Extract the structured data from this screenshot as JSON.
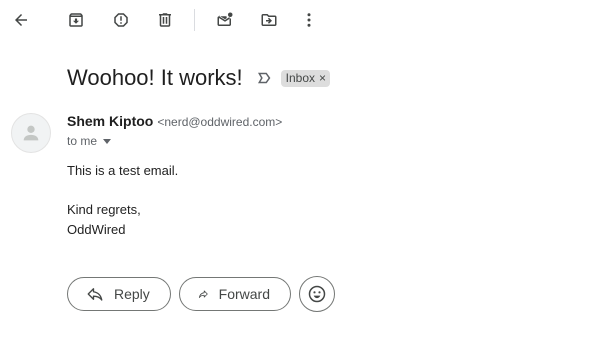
{
  "toolbar": {
    "buttons": [
      {
        "name": "back-arrow-icon",
        "tooltip": "Back"
      },
      {
        "name": "archive-icon",
        "tooltip": "Archive"
      },
      {
        "name": "report-spam-icon",
        "tooltip": "Report spam"
      },
      {
        "name": "delete-icon",
        "tooltip": "Delete"
      },
      {
        "name": "mark-unread-icon",
        "tooltip": "Mark as unread"
      },
      {
        "name": "move-to-icon",
        "tooltip": "Move to"
      },
      {
        "name": "more-vert-icon",
        "tooltip": "More"
      }
    ]
  },
  "message": {
    "subject": "Woohoo! It works!",
    "label": "Inbox",
    "label_close": "×",
    "sender_name": "Shem Kiptoo",
    "sender_email": "<nerd@oddwired.com>",
    "to_text": "to me",
    "body_lines": [
      "This is a test email.",
      "Kind regrets,",
      "OddWired"
    ]
  },
  "actions": {
    "reply_label": "Reply",
    "forward_label": "Forward"
  },
  "colors": {
    "icon": "#444746",
    "chip_bg": "#dddddd",
    "border": "#747775"
  }
}
